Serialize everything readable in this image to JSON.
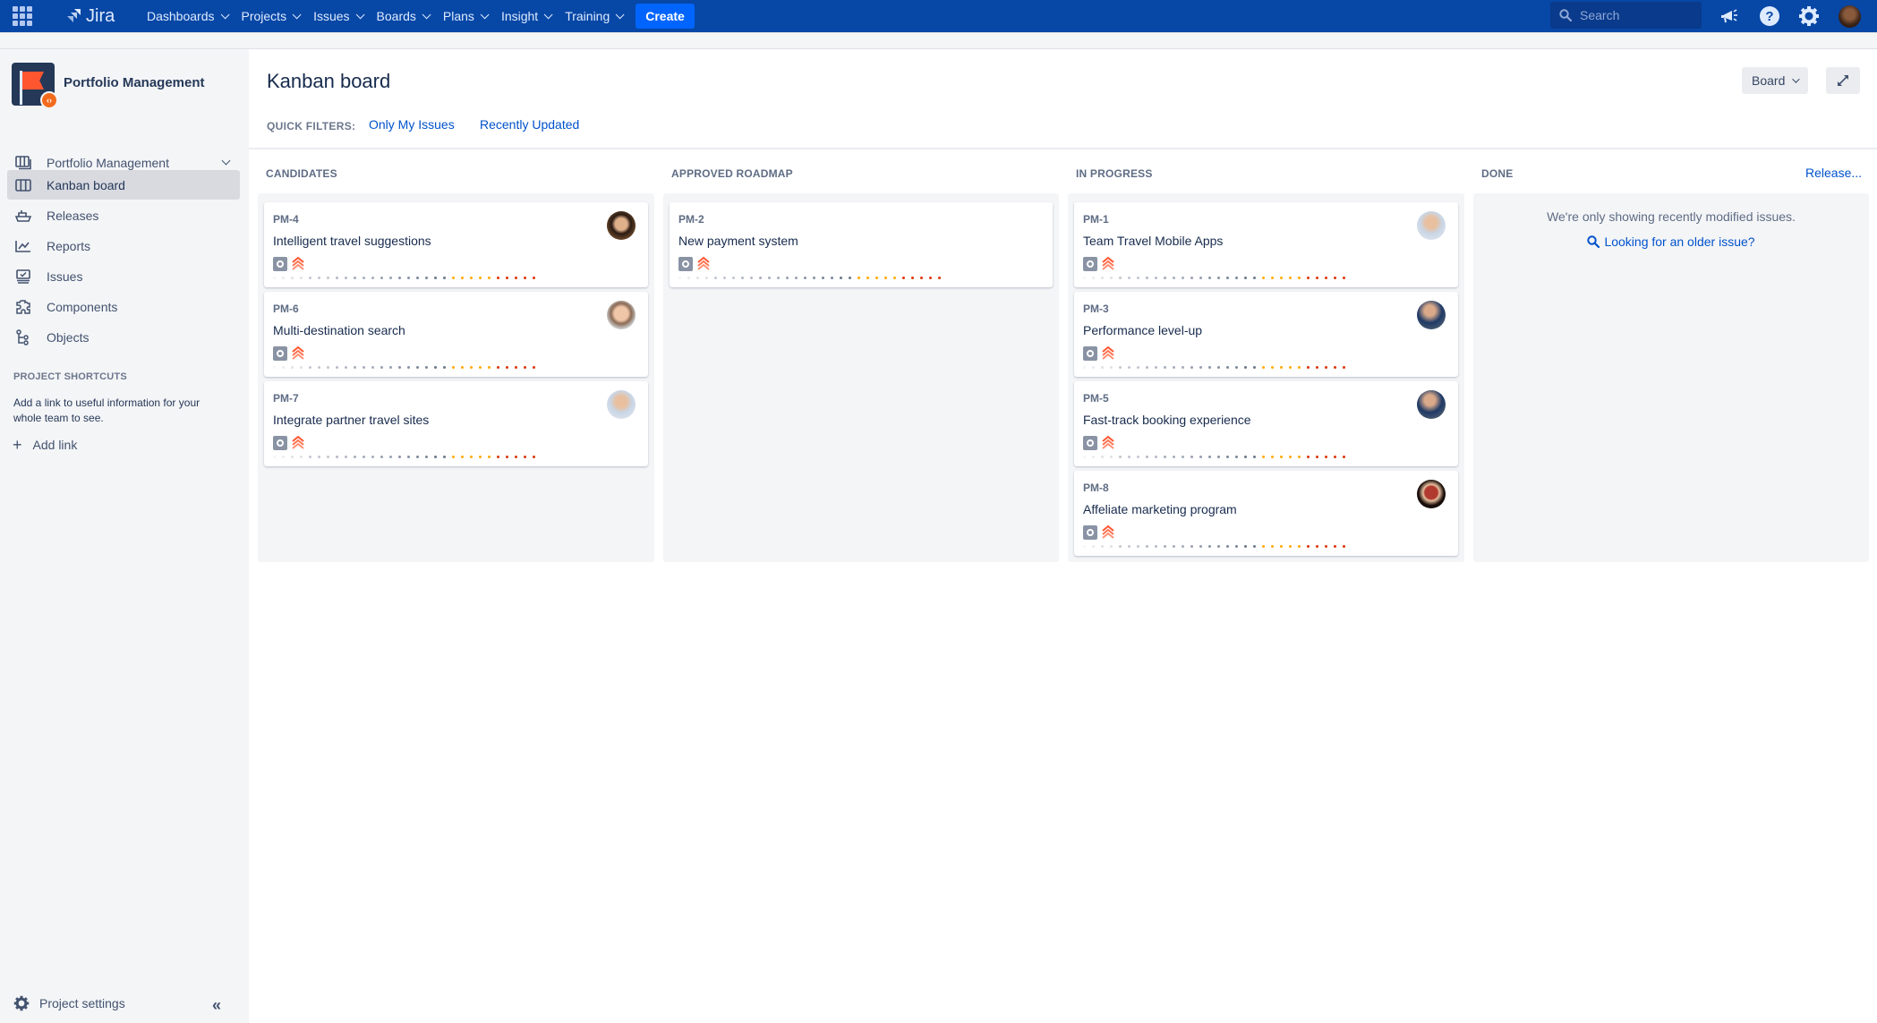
{
  "topnav": {
    "product": "Jira",
    "menus": [
      {
        "label": "Dashboards"
      },
      {
        "label": "Projects"
      },
      {
        "label": "Issues"
      },
      {
        "label": "Boards"
      },
      {
        "label": "Plans"
      },
      {
        "label": "Insight"
      },
      {
        "label": "Training"
      }
    ],
    "create_label": "Create",
    "search_placeholder": "Search",
    "icons": [
      "app-switcher-icon",
      "notifications-icon",
      "help-icon",
      "settings-icon",
      "user-avatar"
    ]
  },
  "sidebar": {
    "project_name": "Portfolio Management",
    "items": [
      {
        "label": "Portfolio Management",
        "icon": "board-selector-icon",
        "dropdown": true
      },
      {
        "label": "Kanban board",
        "icon": "kanban-board-icon",
        "active": true
      },
      {
        "label": "Releases",
        "icon": "releases-icon"
      },
      {
        "label": "Reports",
        "icon": "reports-icon"
      },
      {
        "label": "Issues",
        "icon": "issues-icon"
      },
      {
        "label": "Components",
        "icon": "components-icon"
      },
      {
        "label": "Objects",
        "icon": "objects-icon"
      }
    ],
    "shortcuts_heading": "PROJECT SHORTCUTS",
    "shortcuts_text": "Add a link to useful information for your whole team to see.",
    "add_link_label": "Add link",
    "project_settings_label": "Project settings",
    "collapse_label": "«"
  },
  "main": {
    "title": "Kanban board",
    "board_button": "Board",
    "quick_filters_label": "QUICK FILTERS:",
    "quick_filters": [
      "Only My Issues",
      "Recently Updated"
    ],
    "release_link": "Release...",
    "days_dots": {
      "total": 30,
      "gray": 20,
      "orange": 5,
      "red": 5
    },
    "colors": {
      "brand": "#0747A6",
      "create": "#0065FF",
      "link": "#0052CC",
      "priority_highest": "#FF5630",
      "dot_orange": "#FFAB00",
      "dot_red": "#DE350B"
    },
    "columns": [
      {
        "name": "CANDIDATES",
        "cards": [
          {
            "key": "PM-4",
            "summary": "Intelligent travel suggestions",
            "type": "epic",
            "priority": "Highest",
            "assignee": "avatar-woman"
          },
          {
            "key": "PM-6",
            "summary": "Multi-destination search",
            "type": "epic",
            "priority": "Highest",
            "assignee": "avatar-man-smiling"
          },
          {
            "key": "PM-7",
            "summary": "Integrate partner travel sites",
            "type": "epic",
            "priority": "Highest",
            "assignee": "avatar-man-light"
          }
        ]
      },
      {
        "name": "APPROVED ROADMAP",
        "cards": [
          {
            "key": "PM-2",
            "summary": "New payment system",
            "type": "epic",
            "priority": "Highest",
            "assignee": null
          }
        ]
      },
      {
        "name": "IN PROGRESS",
        "cards": [
          {
            "key": "PM-1",
            "summary": "Team Travel Mobile Apps",
            "type": "epic",
            "priority": "Highest",
            "assignee": "avatar-man-light"
          },
          {
            "key": "PM-3",
            "summary": "Performance level-up",
            "type": "epic",
            "priority": "Highest",
            "assignee": "avatar-man-dark"
          },
          {
            "key": "PM-5",
            "summary": "Fast-track booking experience",
            "type": "epic",
            "priority": "Highest",
            "assignee": "avatar-man-dark"
          },
          {
            "key": "PM-8",
            "summary": "Affeliate marketing program",
            "type": "epic",
            "priority": "Highest",
            "assignee": "avatar-woman-dark"
          }
        ]
      },
      {
        "name": "DONE",
        "cards": [],
        "empty_message": "We're only showing recently modified issues.",
        "older_link": "Looking for an older issue?"
      }
    ]
  }
}
